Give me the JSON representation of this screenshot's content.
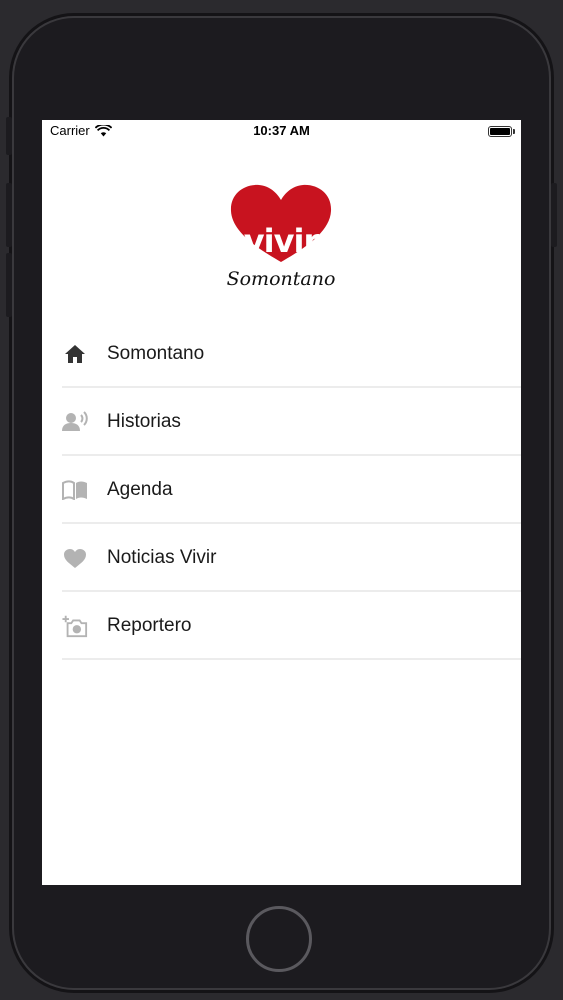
{
  "status_bar": {
    "carrier": "Carrier",
    "time": "10:37 AM",
    "wifi_icon": "wifi-icon",
    "battery_icon": "battery-full-icon"
  },
  "logo": {
    "word": "vivir",
    "subtitle": "Somontano",
    "brand_color": "#c8131f"
  },
  "menu": {
    "items": [
      {
        "label": "Somontano",
        "icon": "home-icon"
      },
      {
        "label": "Historias",
        "icon": "people-speaking-icon"
      },
      {
        "label": "Agenda",
        "icon": "open-book-icon"
      },
      {
        "label": "Noticias Vivir",
        "icon": "heart-icon"
      },
      {
        "label": "Reportero",
        "icon": "add-camera-icon"
      }
    ]
  },
  "colors": {
    "icon_dark": "#333333",
    "icon_gray": "#b3b3b3",
    "divider": "#ececec"
  }
}
